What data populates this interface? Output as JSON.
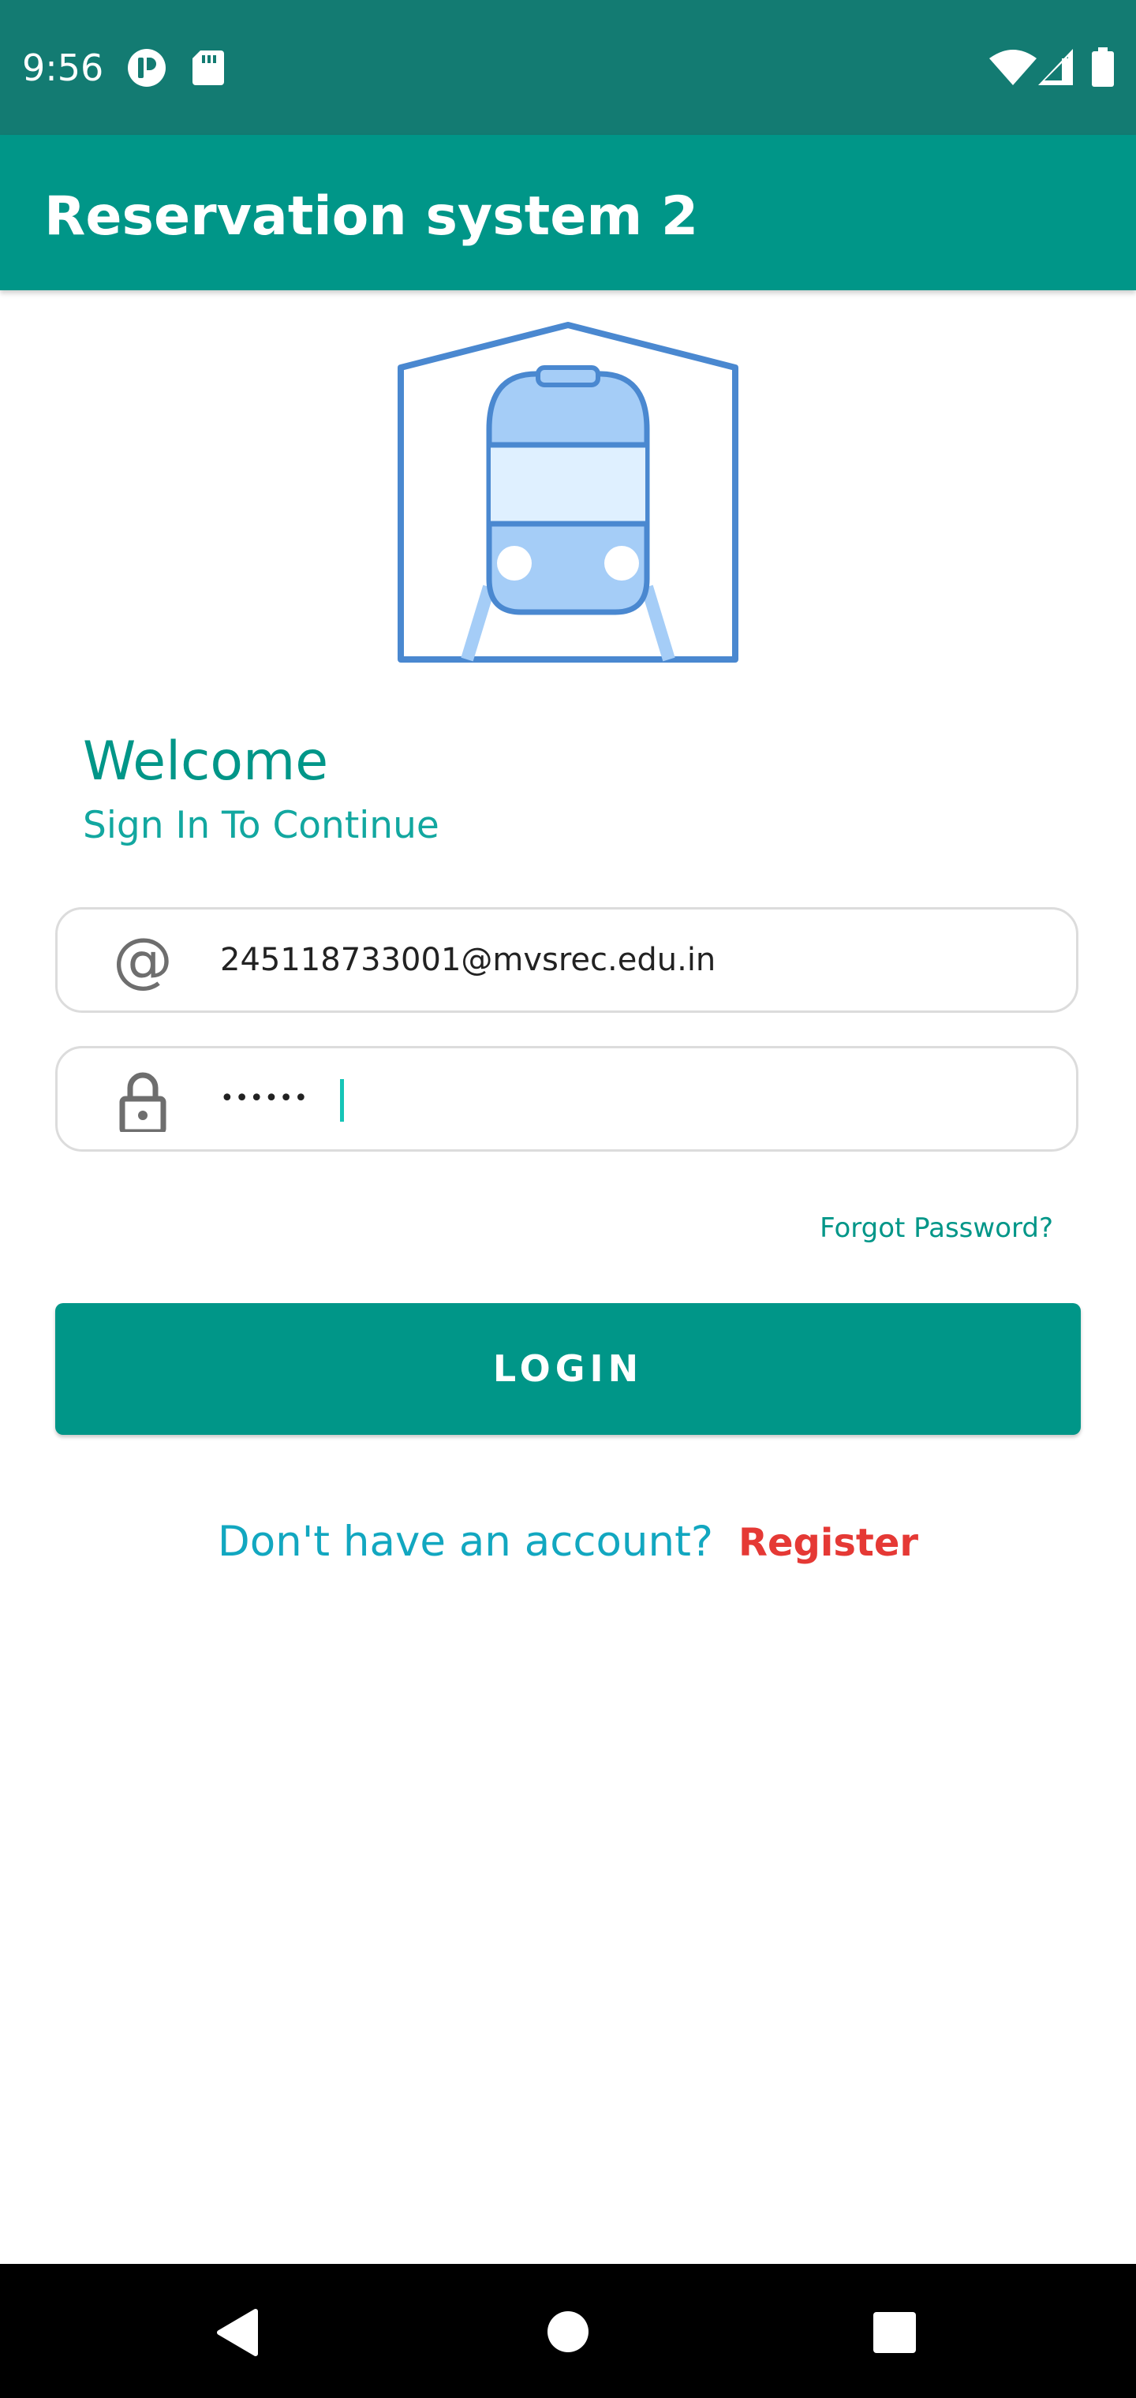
{
  "status_bar": {
    "time": "9:56",
    "icons": [
      "app-notification-icon",
      "sd-card-icon",
      "wifi-icon",
      "cell-signal-icon",
      "battery-icon"
    ]
  },
  "app_bar": {
    "title": "Reservation system 2"
  },
  "logo": {
    "icon": "train-station-icon"
  },
  "welcome": {
    "title": "Welcome",
    "subtitle": "Sign In To Continue"
  },
  "email_field": {
    "icon": "at-sign-icon",
    "value": "245118733001@mvsrec.edu.in"
  },
  "password_field": {
    "icon": "lock-icon",
    "masked_value": "••••••"
  },
  "forgot_password": "Forgot Password?",
  "login_button": "LOGIN",
  "signup": {
    "prompt": "Don't have an account?",
    "link": "Register"
  },
  "nav_bar": {
    "icons": [
      "back-icon",
      "home-icon",
      "recents-icon"
    ]
  },
  "colors": {
    "status_bar": "#137b72",
    "primary": "#009688",
    "accent_text": "#12a7c0",
    "register": "#e53935",
    "logo_stroke": "#4a88d0",
    "logo_fill": "#a5cdf7"
  }
}
